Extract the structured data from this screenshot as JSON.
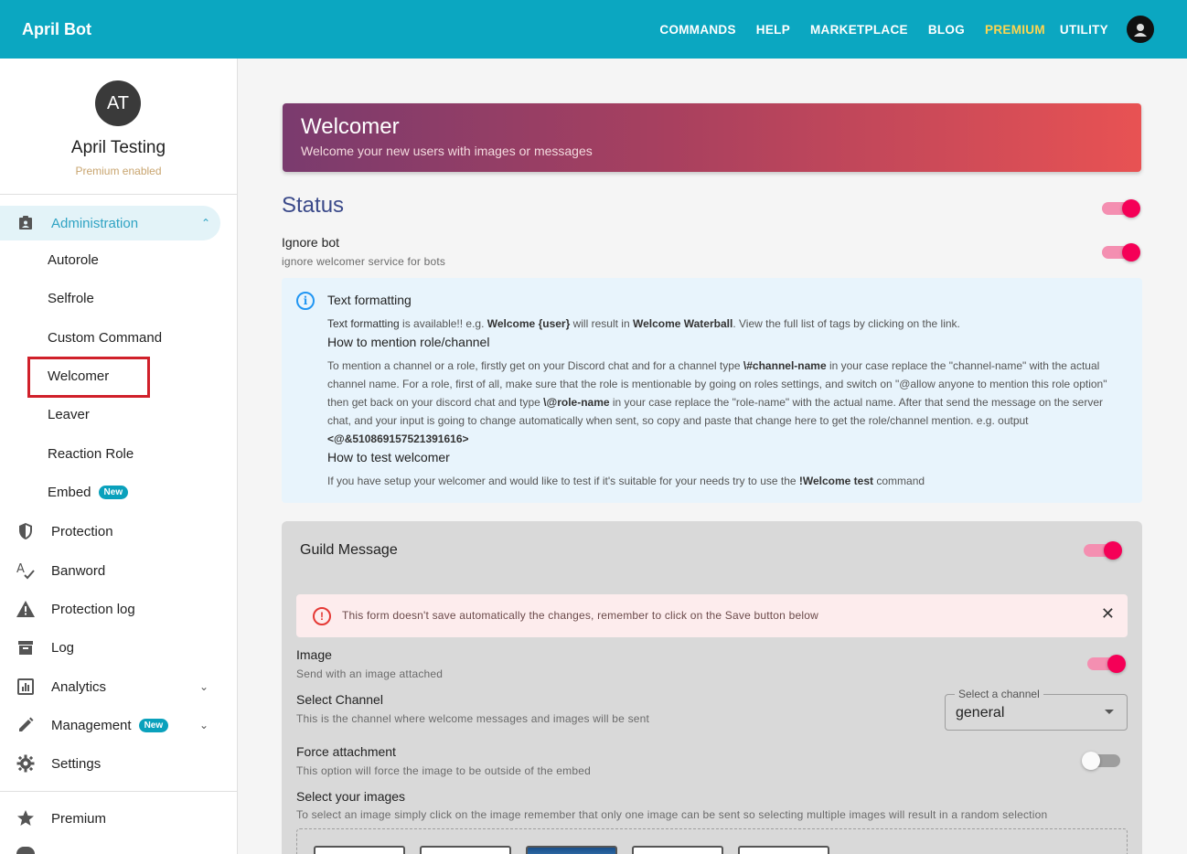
{
  "topbar": {
    "brand": "April Bot",
    "nav": [
      "COMMANDS",
      "HELP",
      "MARKETPLACE",
      "BLOG",
      "PREMIUM",
      "UTILITY"
    ]
  },
  "profile": {
    "initials": "AT",
    "name": "April Testing",
    "status": "Premium enabled"
  },
  "sidebar": {
    "administration": "Administration",
    "sub_items": [
      "Autorole",
      "Selfrole",
      "Custom Command",
      "Welcomer",
      "Leaver",
      "Reaction Role",
      "Embed"
    ],
    "new_badge": "New",
    "items": {
      "protection": "Protection",
      "banword": "Banword",
      "protection_log": "Protection log",
      "log": "Log",
      "analytics": "Analytics",
      "management": "Management",
      "settings": "Settings",
      "premium": "Premium"
    }
  },
  "hero": {
    "title": "Welcomer",
    "subtitle": "Welcome your new users with images or messages"
  },
  "status": {
    "title": "Status",
    "enabled": true,
    "ignore_bot_title": "Ignore bot",
    "ignore_bot_sub": "ignore welcomer service for bots",
    "ignore_bot_enabled": true
  },
  "info": {
    "h1": "Text formatting",
    "p1_a": "Text formatting",
    "p1_b": " is available!! e.g. ",
    "p1_c": "Welcome {user}",
    "p1_d": " will result in ",
    "p1_e": "Welcome Waterball",
    "p1_f": ". View the full list of tags by clicking on the link.",
    "h2": "How to mention role/channel",
    "p2_a": "To mention a channel or a role, firstly get on your Discord chat and for a channel type ",
    "p2_b": "\\#channel-name",
    "p2_c": " in your case replace the \"channel-name\" with the actual channel name. For a role, first of all, make sure that the role is mentionable by going on roles settings, and switch on \"@allow anyone to mention this role option\" then get back on your discord chat and type ",
    "p2_d": "\\@role-name",
    "p2_e": " in your case replace the \"role-name\" with the actual name. After that send the message on the server chat, and your input is going to change automatically when sent, so copy and paste that change here to get the role/channel mention. e.g. output ",
    "p2_f": "<@&510869157521391616>",
    "h3": "How to test welcomer",
    "p3_a": "If you have setup your welcomer and would like to test if it's suitable for your needs try to use the ",
    "p3_b": "!Welcome test",
    "p3_c": " command"
  },
  "guild": {
    "title": "Guild Message",
    "enabled": true,
    "alert": "This form doesn't save automatically the changes, remember to click on the Save button below",
    "image_title": "Image",
    "image_sub": "Send with an image attached",
    "image_enabled": true,
    "channel_title": "Select Channel",
    "channel_sub": "This is the channel where welcome messages and images will be sent",
    "channel_label": "Select a channel",
    "channel_value": "general",
    "force_title": "Force attachment",
    "force_sub": "This option will force the image to be outside of the embed",
    "force_enabled": false,
    "images_title": "Select your images",
    "images_sub": "To select an image simply click on the image remember that only one image can be sent so selecting multiple images will result in a random selection"
  },
  "colors": {
    "topbar": "#0ba7c1",
    "premium": "#ffd54f",
    "accent_toggle": "#f50057",
    "active_nav": "#2fa3c3"
  }
}
